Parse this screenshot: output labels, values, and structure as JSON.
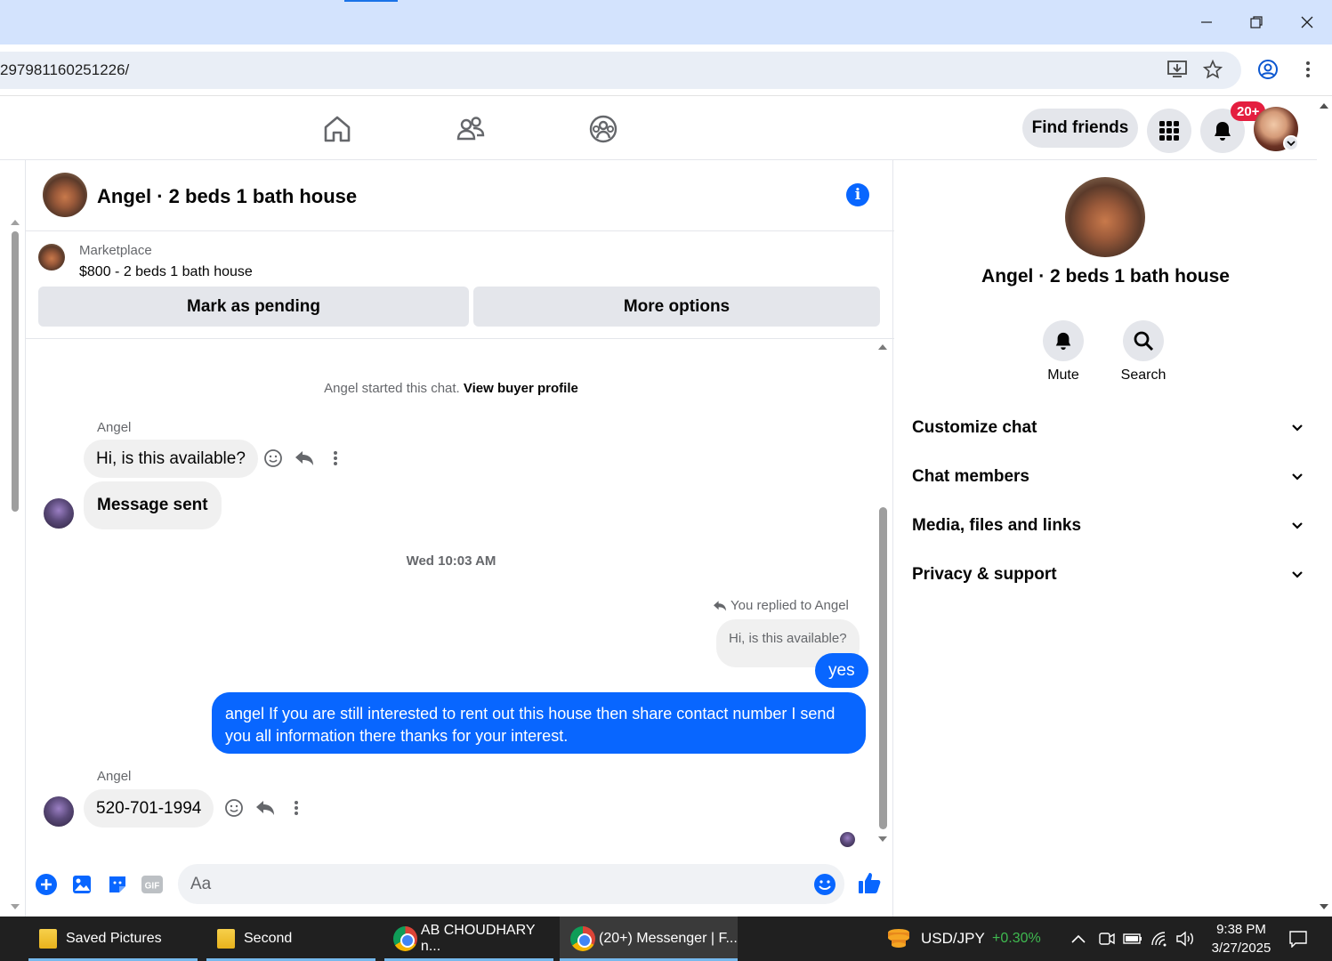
{
  "browser": {
    "url_fragment": "297981160251226/"
  },
  "header": {
    "find_friends_label": "Find friends",
    "notification_badge": "20+"
  },
  "chat": {
    "title": "Angel · 2 beds 1 bath house",
    "marketplace_label": "Marketplace",
    "listing": "$800 - 2 beds 1 bath house",
    "mark_pending_label": "Mark as pending",
    "more_options_label": "More options",
    "started_text": "Angel started this chat.",
    "view_profile_label": "View buyer profile",
    "messages": {
      "sender1": "Angel",
      "msg1": "Hi, is this available?",
      "msg2": "Message sent",
      "timestamp": "Wed 10:03 AM",
      "reply_label": "You replied to Angel",
      "quoted": "Hi, is this available?",
      "msg3": "yes",
      "msg4": "angel If you are still interested to rent out this house then share contact number  I send you all information there thanks for your interest.",
      "sender2": "Angel",
      "msg5": "520-701-1994"
    },
    "composer_placeholder": "Aa"
  },
  "info_panel": {
    "title": "Angel · 2 beds 1 bath house",
    "mute_label": "Mute",
    "search_label": "Search",
    "sections": [
      "Customize chat",
      "Chat members",
      "Media, files and links",
      "Privacy & support"
    ]
  },
  "taskbar": {
    "items": [
      "Saved Pictures",
      "Second",
      "AB CHOUDHARY n...",
      "(20+) Messenger | F..."
    ],
    "ticker_name": "USD/JPY",
    "ticker_change": "+0.30%",
    "time": "9:38 PM",
    "date": "3/27/2025"
  },
  "colors": {
    "accent_blue": "#0866ff",
    "badge_red": "#e41e3f",
    "ticker_green": "#3fb950"
  }
}
